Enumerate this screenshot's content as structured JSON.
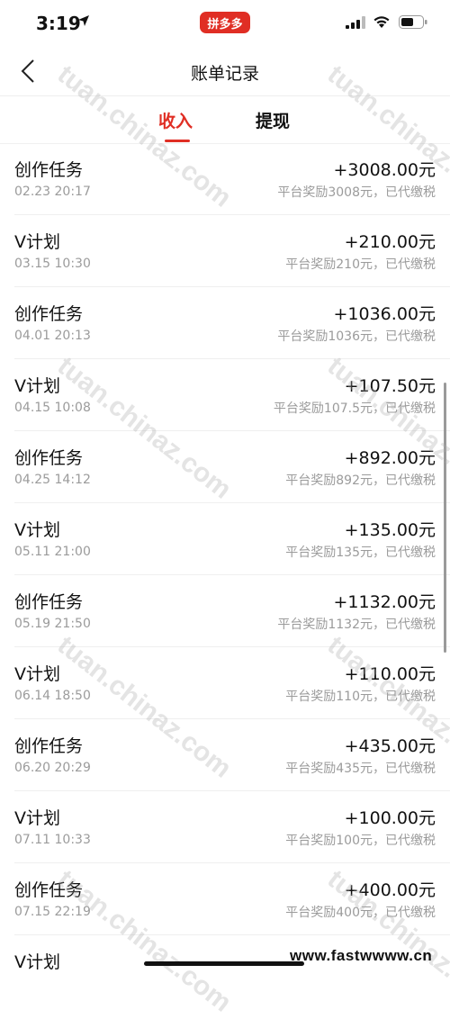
{
  "status_bar": {
    "time": "3:19",
    "app_badge": "拼多多"
  },
  "nav": {
    "title": "账单记录"
  },
  "tabs": [
    {
      "label": "收入",
      "active": true
    },
    {
      "label": "提现",
      "active": false
    }
  ],
  "records": [
    {
      "title": "创作任务",
      "date": "02.23 20:17",
      "amount": "+3008.00元",
      "note": "平台奖励3008元，已代缴税"
    },
    {
      "title": "V计划",
      "date": "03.15 10:30",
      "amount": "+210.00元",
      "note": "平台奖励210元，已代缴税"
    },
    {
      "title": "创作任务",
      "date": "04.01 20:13",
      "amount": "+1036.00元",
      "note": "平台奖励1036元，已代缴税"
    },
    {
      "title": "V计划",
      "date": "04.15 10:08",
      "amount": "+107.50元",
      "note": "平台奖励107.5元，已代缴税"
    },
    {
      "title": "创作任务",
      "date": "04.25 14:12",
      "amount": "+892.00元",
      "note": "平台奖励892元，已代缴税"
    },
    {
      "title": "V计划",
      "date": "05.11 21:00",
      "amount": "+135.00元",
      "note": "平台奖励135元，已代缴税"
    },
    {
      "title": "创作任务",
      "date": "05.19 21:50",
      "amount": "+1132.00元",
      "note": "平台奖励1132元，已代缴税"
    },
    {
      "title": "V计划",
      "date": "06.14 18:50",
      "amount": "+110.00元",
      "note": "平台奖励110元，已代缴税"
    },
    {
      "title": "创作任务",
      "date": "06.20 20:29",
      "amount": "+435.00元",
      "note": "平台奖励435元，已代缴税"
    },
    {
      "title": "V计划",
      "date": "07.11 10:33",
      "amount": "+100.00元",
      "note": "平台奖励100元，已代缴税"
    },
    {
      "title": "创作任务",
      "date": "07.15 22:19",
      "amount": "+400.00元",
      "note": "平台奖励400元，已代缴税"
    },
    {
      "title": "V计划",
      "date": "",
      "amount": "",
      "note": ""
    }
  ],
  "watermarks": {
    "text": "tuan.chinaz.com",
    "corner": "www.fastwwww.cn"
  },
  "colors": {
    "accent": "#e02e24"
  }
}
